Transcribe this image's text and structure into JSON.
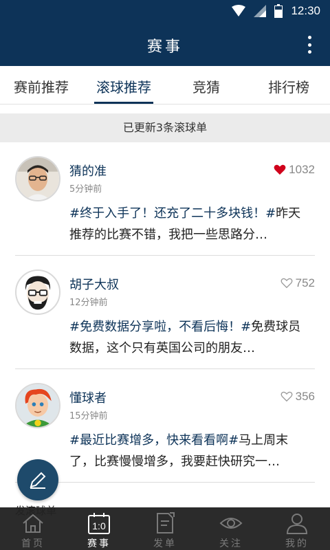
{
  "status_bar": {
    "time": "12:30",
    "icons": [
      "wifi-icon",
      "signal-icon",
      "battery-icon"
    ]
  },
  "app_bar": {
    "title": "赛事",
    "menu_icon": "more-vert-icon"
  },
  "tabs": [
    {
      "label": "赛前推荐",
      "active": false
    },
    {
      "label": "滚球推荐",
      "active": true
    },
    {
      "label": "竞猜",
      "active": false
    },
    {
      "label": "排行榜",
      "active": false
    }
  ],
  "banner": {
    "text": "已更新3条滚球单"
  },
  "posts": [
    {
      "name": "猜的准",
      "time": "5分钟前",
      "likes": "1032",
      "liked": true,
      "tag1": "#终于入手了！还充了二十多块钱！#",
      "text1": "昨天推荐的比赛不错，我把一些思路分…"
    },
    {
      "name": "胡子大叔",
      "time": "12分钟前",
      "likes": "752",
      "liked": false,
      "tag1": "#免费数据分享啦，不看后悔！#",
      "text1": "免费球员数据，这个只有英国公司的朋友…"
    },
    {
      "name": "懂球者",
      "time": "15分钟前",
      "likes": "356",
      "liked": false,
      "tag1": "#最近比赛增多，快来看看啊#",
      "text1": "马上周末了，比赛慢慢增多，我要赶快研究一…"
    }
  ],
  "fab": {
    "label": "发滚球单",
    "icon": "pencil-icon"
  },
  "bottom_nav": [
    {
      "label": "首页",
      "icon": "home-icon",
      "active": false
    },
    {
      "label": "赛事",
      "icon": "scoreboard-icon",
      "active": true
    },
    {
      "label": "发单",
      "icon": "document-edit-icon",
      "active": false
    },
    {
      "label": "关注",
      "icon": "eye-icon",
      "active": false
    },
    {
      "label": "我的",
      "icon": "user-icon",
      "active": false
    }
  ],
  "colors": {
    "primary": "#0d3358",
    "like_red": "#d0021b",
    "nav_bg": "#2b2b2b"
  }
}
